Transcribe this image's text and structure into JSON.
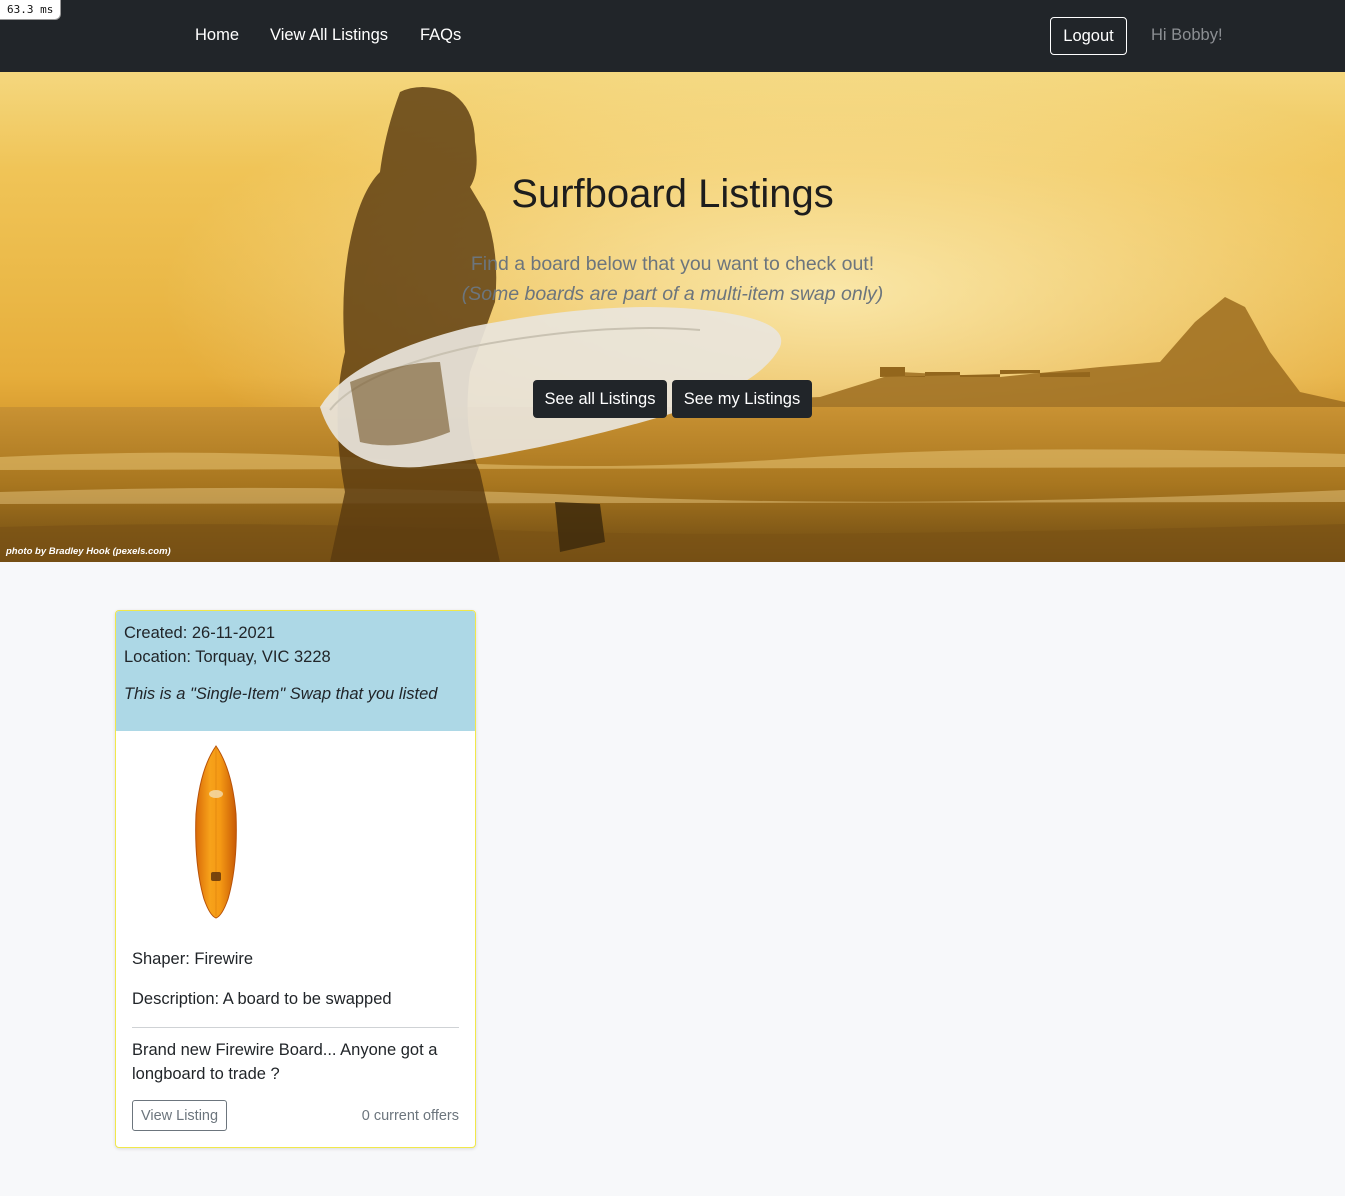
{
  "timer": "63.3 ms",
  "navbar": {
    "links": [
      "Home",
      "View All Listings",
      "FAQs"
    ],
    "logout_label": "Logout",
    "greeting": "Hi Bobby!"
  },
  "hero": {
    "title": "Surfboard Listings",
    "subtitle": "Find a board below that you want to check out!",
    "subtitle_note": "(Some boards are part of a multi-item swap only)",
    "buttons": [
      "See all Listings",
      "See my Listings"
    ],
    "photo_credit": "photo by Bradley Hook (pexels.com)"
  },
  "listing": {
    "created": "Created: 26-11-2021",
    "location": "Location: Torquay, VIC 3228",
    "swap_note": "This is a \"Single-Item\" Swap that you listed",
    "shaper": "Shaper: Firewire",
    "description": "Description: A board to be swapped",
    "blurb": "Brand new Firewire Board... Anyone got a longboard to trade ?",
    "view_label": "View Listing",
    "offers": "0 current offers",
    "image": "surfboard-image"
  },
  "colors": {
    "navbar": "#212529",
    "card_header": "#add8e6",
    "card_border": "#f1e84a",
    "page_bg": "#f7f8fa"
  }
}
